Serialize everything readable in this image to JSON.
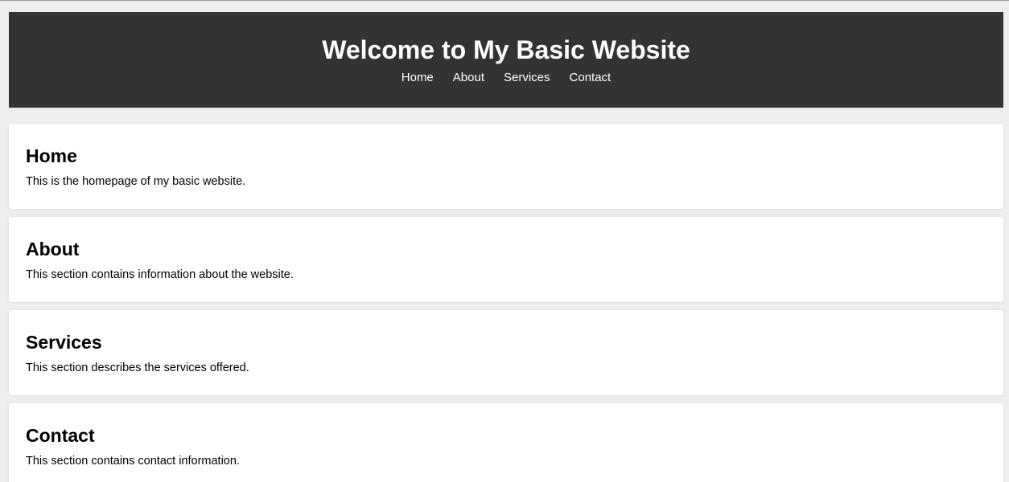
{
  "header": {
    "title": "Welcome to My Basic Website",
    "nav": [
      "Home",
      "About",
      "Services",
      "Contact"
    ]
  },
  "sections": [
    {
      "heading": "Home",
      "text": "This is the homepage of my basic website."
    },
    {
      "heading": "About",
      "text": "This section contains information about the website."
    },
    {
      "heading": "Services",
      "text": "This section describes the services offered."
    },
    {
      "heading": "Contact",
      "text": "This section contains contact information."
    }
  ],
  "colors": {
    "header_bg": "#333333",
    "page_bg": "#eeeeee",
    "card_bg": "#ffffff"
  }
}
